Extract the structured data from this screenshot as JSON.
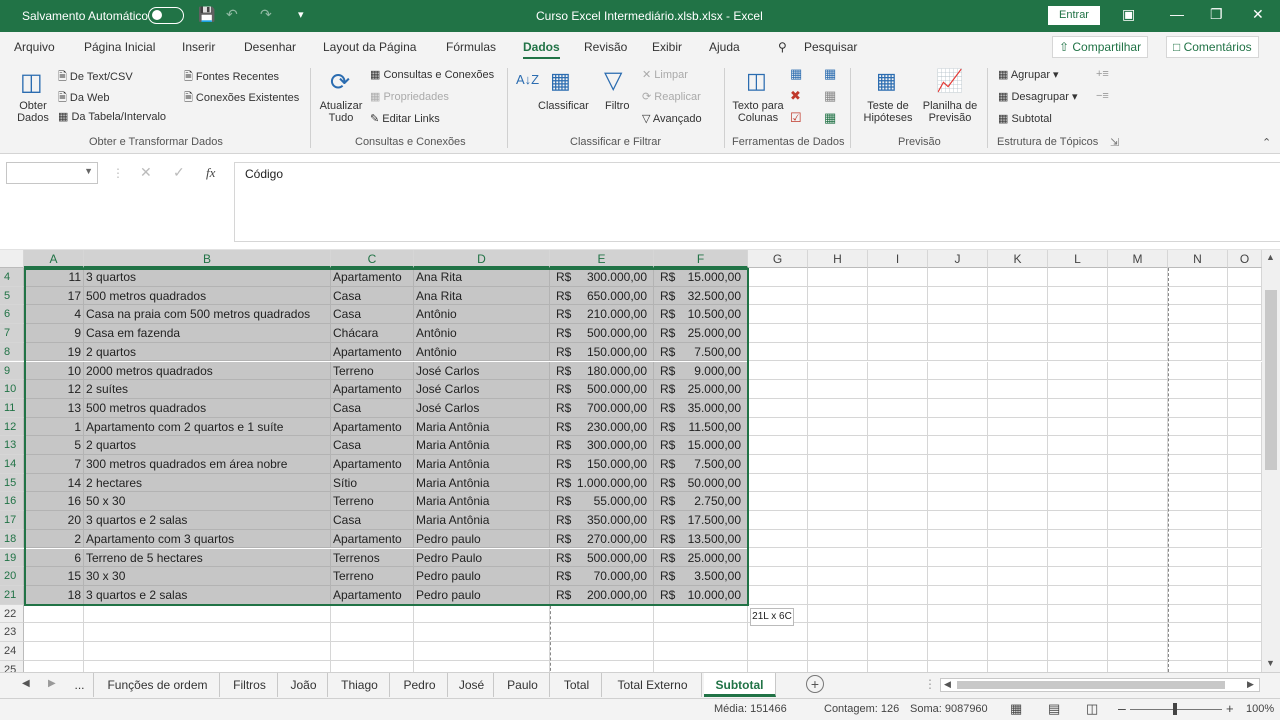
{
  "titlebar": {
    "autosave_label": "Salvamento Automático",
    "document_title": "Curso Excel Intermediário.xlsb.xlsx  -  Excel",
    "signin_label": "Entrar"
  },
  "menu": {
    "items": [
      "Arquivo",
      "Página Inicial",
      "Inserir",
      "Desenhar",
      "Layout da Página",
      "Fórmulas",
      "Dados",
      "Revisão",
      "Exibir",
      "Ajuda"
    ],
    "active": "Dados",
    "search": "Pesquisar",
    "share": "Compartilhar",
    "comments": "Comentários"
  },
  "ribbon": {
    "get_data": "Obter Dados",
    "from_text": "De Text/CSV",
    "from_web": "Da Web",
    "from_table": "Da Tabela/Intervalo",
    "recent_sources": "Fontes Recentes",
    "existing_connections": "Conexões Existentes",
    "group1": "Obter e Transformar Dados",
    "refresh_all": "Atualizar Tudo",
    "queries_connections": "Consultas e Conexões",
    "properties": "Propriedades",
    "edit_links": "Editar Links",
    "group2": "Consultas e Conexões",
    "sort": "Classificar",
    "filter": "Filtro",
    "clear": "Limpar",
    "reapply": "Reaplicar",
    "advanced": "Avançado",
    "group3": "Classificar e Filtrar",
    "text_to_columns": "Texto para Colunas",
    "group4": "Ferramentas de Dados",
    "what_if": "Teste de Hipóteses",
    "forecast_sheet": "Planilha de Previsão",
    "group5": "Previsão",
    "group_btn": "Agrupar",
    "ungroup_btn": "Desagrupar",
    "subtotal_btn": "Subtotal",
    "group6": "Estrutura de Tópicos"
  },
  "formula_bar": {
    "name_box": "",
    "content": "Código",
    "fx": "fx"
  },
  "columns": [
    "A",
    "B",
    "C",
    "D",
    "E",
    "F",
    "G",
    "H",
    "I",
    "J",
    "K",
    "L",
    "M",
    "N",
    "O"
  ],
  "rows": [
    {
      "n": "4",
      "a": "11",
      "b": "3 quartos",
      "c": "Apartamento",
      "d": "Ana Rita",
      "e": "300.000,00",
      "f": "15.000,00"
    },
    {
      "n": "5",
      "a": "17",
      "b": "500 metros quadrados",
      "c": "Casa",
      "d": "Ana Rita",
      "e": "650.000,00",
      "f": "32.500,00"
    },
    {
      "n": "6",
      "a": "4",
      "b": "Casa na praia com 500 metros quadrados",
      "c": "Casa",
      "d": "Antônio",
      "e": "210.000,00",
      "f": "10.500,00"
    },
    {
      "n": "7",
      "a": "9",
      "b": "Casa em fazenda",
      "c": "Chácara",
      "d": "Antônio",
      "e": "500.000,00",
      "f": "25.000,00"
    },
    {
      "n": "8",
      "a": "19",
      "b": "2 quartos",
      "c": "Apartamento",
      "d": "Antônio",
      "e": "150.000,00",
      "f": "7.500,00"
    },
    {
      "n": "9",
      "a": "10",
      "b": "2000 metros quadrados",
      "c": "Terreno",
      "d": "José Carlos",
      "e": "180.000,00",
      "f": "9.000,00"
    },
    {
      "n": "10",
      "a": "12",
      "b": "2 suítes",
      "c": "Apartamento",
      "d": "José Carlos",
      "e": "500.000,00",
      "f": "25.000,00"
    },
    {
      "n": "11",
      "a": "13",
      "b": "500 metros quadrados",
      "c": "Casa",
      "d": "José Carlos",
      "e": "700.000,00",
      "f": "35.000,00"
    },
    {
      "n": "12",
      "a": "1",
      "b": "Apartamento com 2 quartos e 1 suíte",
      "c": "Apartamento",
      "d": "Maria Antônia",
      "e": "230.000,00",
      "f": "11.500,00"
    },
    {
      "n": "13",
      "a": "5",
      "b": "2  quartos",
      "c": "Casa",
      "d": "Maria Antônia",
      "e": "300.000,00",
      "f": "15.000,00"
    },
    {
      "n": "14",
      "a": "7",
      "b": "300 metros quadrados em área nobre",
      "c": "Apartamento",
      "d": "Maria Antônia",
      "e": "150.000,00",
      "f": "7.500,00"
    },
    {
      "n": "15",
      "a": "14",
      "b": "2 hectares",
      "c": "Sítio",
      "d": "Maria Antônia",
      "e": "1.000.000,00",
      "f": "50.000,00"
    },
    {
      "n": "16",
      "a": "16",
      "b": "50 x 30",
      "c": "Terreno",
      "d": "Maria Antônia",
      "e": "55.000,00",
      "f": "2.750,00"
    },
    {
      "n": "17",
      "a": "20",
      "b": "3 quartos e 2 salas",
      "c": "Casa",
      "d": "Maria Antônia",
      "e": "350.000,00",
      "f": "17.500,00"
    },
    {
      "n": "18",
      "a": "2",
      "b": "Apartamento com 3 quartos",
      "c": "Apartamento",
      "d": "Pedro paulo",
      "e": "270.000,00",
      "f": "13.500,00"
    },
    {
      "n": "19",
      "a": "6",
      "b": "Terreno de 5 hectares",
      "c": "Terrenos",
      "d": "Pedro Paulo",
      "e": "500.000,00",
      "f": "25.000,00"
    },
    {
      "n": "20",
      "a": "15",
      "b": "30 x 30",
      "c": "Terreno",
      "d": "Pedro paulo",
      "e": "70.000,00",
      "f": "3.500,00"
    },
    {
      "n": "21",
      "a": "18",
      "b": "3 quartos e 2 salas",
      "c": "Apartamento",
      "d": "Pedro paulo",
      "e": "200.000,00",
      "f": "10.000,00"
    },
    {
      "n": "22",
      "a": "",
      "b": "",
      "c": "",
      "d": "",
      "e": "",
      "f": ""
    },
    {
      "n": "23",
      "a": "",
      "b": "",
      "c": "",
      "d": "",
      "e": "",
      "f": ""
    },
    {
      "n": "24",
      "a": "",
      "b": "",
      "c": "",
      "d": "",
      "e": "",
      "f": ""
    },
    {
      "n": "25",
      "a": "",
      "b": "",
      "c": "",
      "d": "",
      "e": "",
      "f": ""
    }
  ],
  "currency": "R$",
  "selection_tooltip": "21L x 6C",
  "sheets": [
    "...",
    "Funções de ordem",
    "Filtros",
    "João",
    "Thiago",
    "Pedro",
    "José",
    "Paulo",
    "Total",
    "Total Externo",
    "Subtotal"
  ],
  "active_sheet": "Subtotal",
  "status": {
    "average": "Média: 151466",
    "count": "Contagem: 126",
    "sum": "Soma: 9087960",
    "zoom": "100%"
  }
}
